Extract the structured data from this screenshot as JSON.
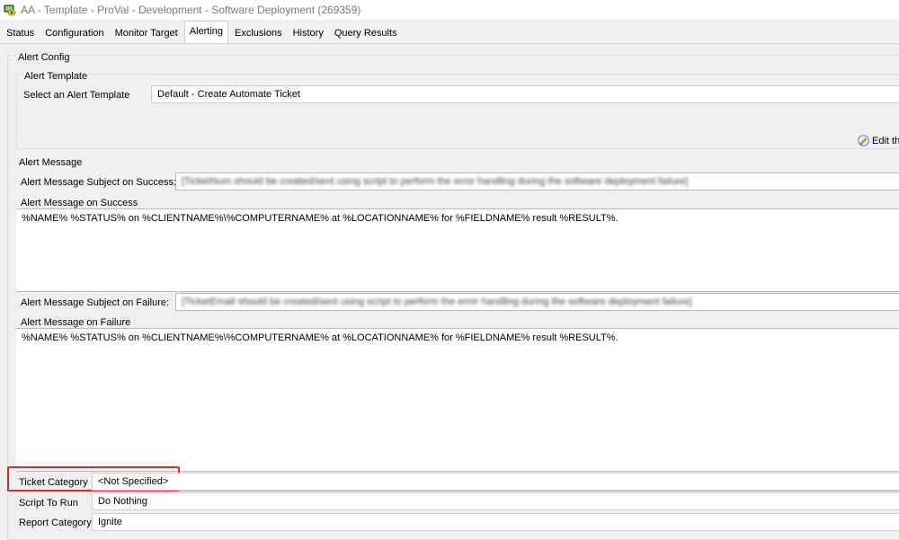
{
  "window": {
    "title": "AA - Template - ProVal - Development - Software Deployment (269359)",
    "icon": "monitor-app-icon"
  },
  "tabs": [
    {
      "label": "Status",
      "active": false
    },
    {
      "label": "Configuration",
      "active": false
    },
    {
      "label": "Monitor Target",
      "active": false
    },
    {
      "label": "Alerting",
      "active": true
    },
    {
      "label": "Exclusions",
      "active": false
    },
    {
      "label": "History",
      "active": false
    },
    {
      "label": "Query Results",
      "active": false
    }
  ],
  "alert_config": {
    "group_label": "Alert Config",
    "template_group_label": "Alert Template",
    "select_label": "Select an Alert Template",
    "template_value": "Default - Create Automate Ticket",
    "edit_button_label": "Edit th"
  },
  "alert_message": {
    "section_label": "Alert Message",
    "subject_success_label": "Alert Message Subject on Success:",
    "subject_success_value": "[TicketNum should be created/sent using script to perform the error handling during the software deployment failure]",
    "success_label": "Alert Message on Success",
    "success_body": "%NAME% %STATUS% on %CLIENTNAME%\\%COMPUTERNAME% at %LOCATIONNAME% for %FIELDNAME% result %RESULT%.",
    "subject_failure_label": "Alert Message Subject on Failure:",
    "subject_failure_value": "[TicketEmail should be created/sent using script to perform the error handling during the software deployment failure]",
    "failure_label": "Alert Message on Failure",
    "failure_body": "%NAME% %STATUS% on %CLIENTNAME%\\%COMPUTERNAME% at %LOCATIONNAME% for %FIELDNAME% result %RESULT%."
  },
  "ticket": {
    "category_label": "Ticket Category",
    "category_value": "<Not Specified>",
    "script_label": "Script To Run",
    "script_value": "Do Nothing",
    "report_label": "Report Category",
    "report_value": "Ignite"
  },
  "colors": {
    "highlight": "#e0262c",
    "background": "#f0f0f0"
  }
}
